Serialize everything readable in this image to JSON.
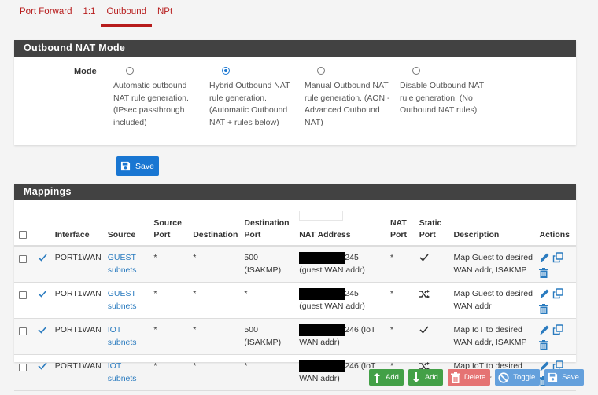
{
  "tabs": [
    {
      "label": "Port Forward",
      "active": false
    },
    {
      "label": "1:1",
      "active": false
    },
    {
      "label": "Outbound",
      "active": true
    },
    {
      "label": "NPt",
      "active": false
    }
  ],
  "mode_panel": {
    "title": "Outbound NAT Mode",
    "mode_label": "Mode",
    "options": [
      {
        "label": "Automatic outbound NAT rule generation. (IPsec passthrough included)",
        "checked": false
      },
      {
        "label": "Hybrid Outbound NAT rule generation. (Automatic Outbound NAT + rules below)",
        "checked": true
      },
      {
        "label": "Manual Outbound NAT rule generation. (AON - Advanced Outbound NAT)",
        "checked": false
      },
      {
        "label": "Disable Outbound NAT rule generation. (No Outbound NAT rules)",
        "checked": false
      }
    ],
    "save_label": "Save"
  },
  "mappings": {
    "title": "Mappings",
    "columns": [
      "",
      "",
      "Interface",
      "Source",
      "Source Port",
      "Destination",
      "Destination Port",
      "NAT Address",
      "NAT Port",
      "Static Port",
      "Description",
      "Actions"
    ],
    "rows": [
      {
        "enabled_icon": "check-icon",
        "interface": "PORT1WAN",
        "source": "GUEST subnets",
        "source_port": "*",
        "destination": "*",
        "destination_port": "500 (ISAKMP)",
        "nat_address_suffix": "245",
        "nat_address_note": "(guest WAN addr)",
        "nat_port": "*",
        "static_port_icon": "check-icon",
        "description": "Map Guest to desired WAN addr, ISAKMP"
      },
      {
        "enabled_icon": "check-icon",
        "interface": "PORT1WAN",
        "source": "GUEST subnets",
        "source_port": "*",
        "destination": "*",
        "destination_port": "*",
        "nat_address_suffix": "245",
        "nat_address_note": "(guest WAN addr)",
        "nat_port": "*",
        "static_port_icon": "random-icon",
        "description": "Map Guest to desired WAN addr"
      },
      {
        "enabled_icon": "check-icon",
        "interface": "PORT1WAN",
        "source": "IOT subnets",
        "source_port": "*",
        "destination": "*",
        "destination_port": "500 (ISAKMP)",
        "nat_address_suffix": "246 (IoT",
        "nat_address_note": "WAN addr)",
        "nat_port": "*",
        "static_port_icon": "check-icon",
        "description": "Map IoT to desired WAN addr, ISAKMP"
      },
      {
        "enabled_icon": "check-icon",
        "interface": "PORT1WAN",
        "source": "IOT subnets",
        "source_port": "*",
        "destination": "*",
        "destination_port": "*",
        "nat_address_suffix": "246 (IoT",
        "nat_address_note": "WAN addr)",
        "nat_port": "*",
        "static_port_icon": "random-icon",
        "description": "Map IoT to desired WAN addr"
      }
    ]
  },
  "bottom_buttons": {
    "add_top": "Add",
    "add_bottom": "Add",
    "delete": "Delete",
    "toggle": "Toggle",
    "save": "Save"
  },
  "colors": {
    "accent_red": "#b71c1c",
    "panel_header": "#424242",
    "primary_blue": "#1976d2",
    "success_green": "#43a047",
    "danger_red": "#e57373",
    "link_blue": "#2a7bbf"
  }
}
